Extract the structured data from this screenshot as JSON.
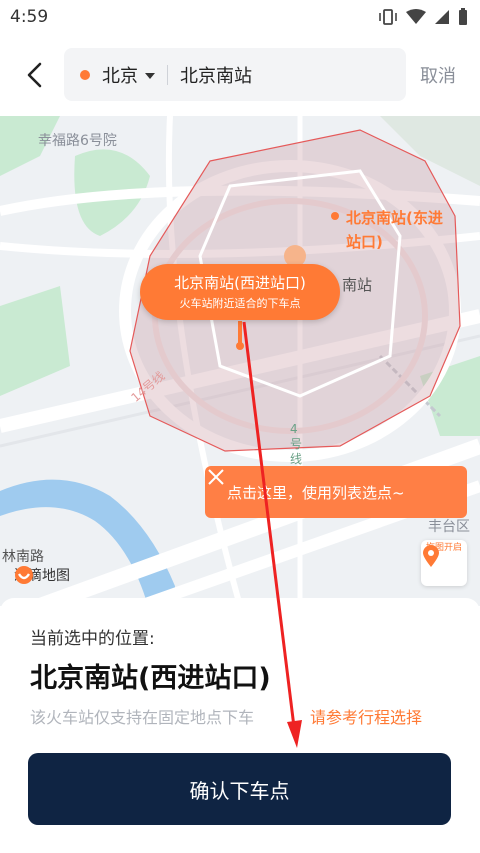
{
  "status": {
    "time": "4:59"
  },
  "header": {
    "city": "北京",
    "search_value": "北京南站",
    "cancel_label": "取消"
  },
  "map": {
    "street_label": "幸福路6号院",
    "east_exit_label": "北京南站(东进站口)",
    "station_label": "南站",
    "line14_label": "14号线",
    "line4_label": "4号线",
    "road_label": "林南路",
    "district_label": "丰台区",
    "logo": "滴滴地图",
    "bubble_title": "北京南站(西进站口)",
    "bubble_subtitle": "火车站附近适合的下车点",
    "tip_text": "点击这里，使用列表选点~",
    "drag_label": "拖图开启"
  },
  "sheet": {
    "current_label": "当前选中的位置:",
    "location_name": "北京南站(西进站口)",
    "note": "该火车站仅支持在固定地点下车",
    "link": "请参考行程选择",
    "confirm_label": "确认下车点"
  },
  "colors": {
    "accent": "#ff7a35",
    "confirm_bg": "#0f2443",
    "zone_stroke": "#e55a5a"
  }
}
